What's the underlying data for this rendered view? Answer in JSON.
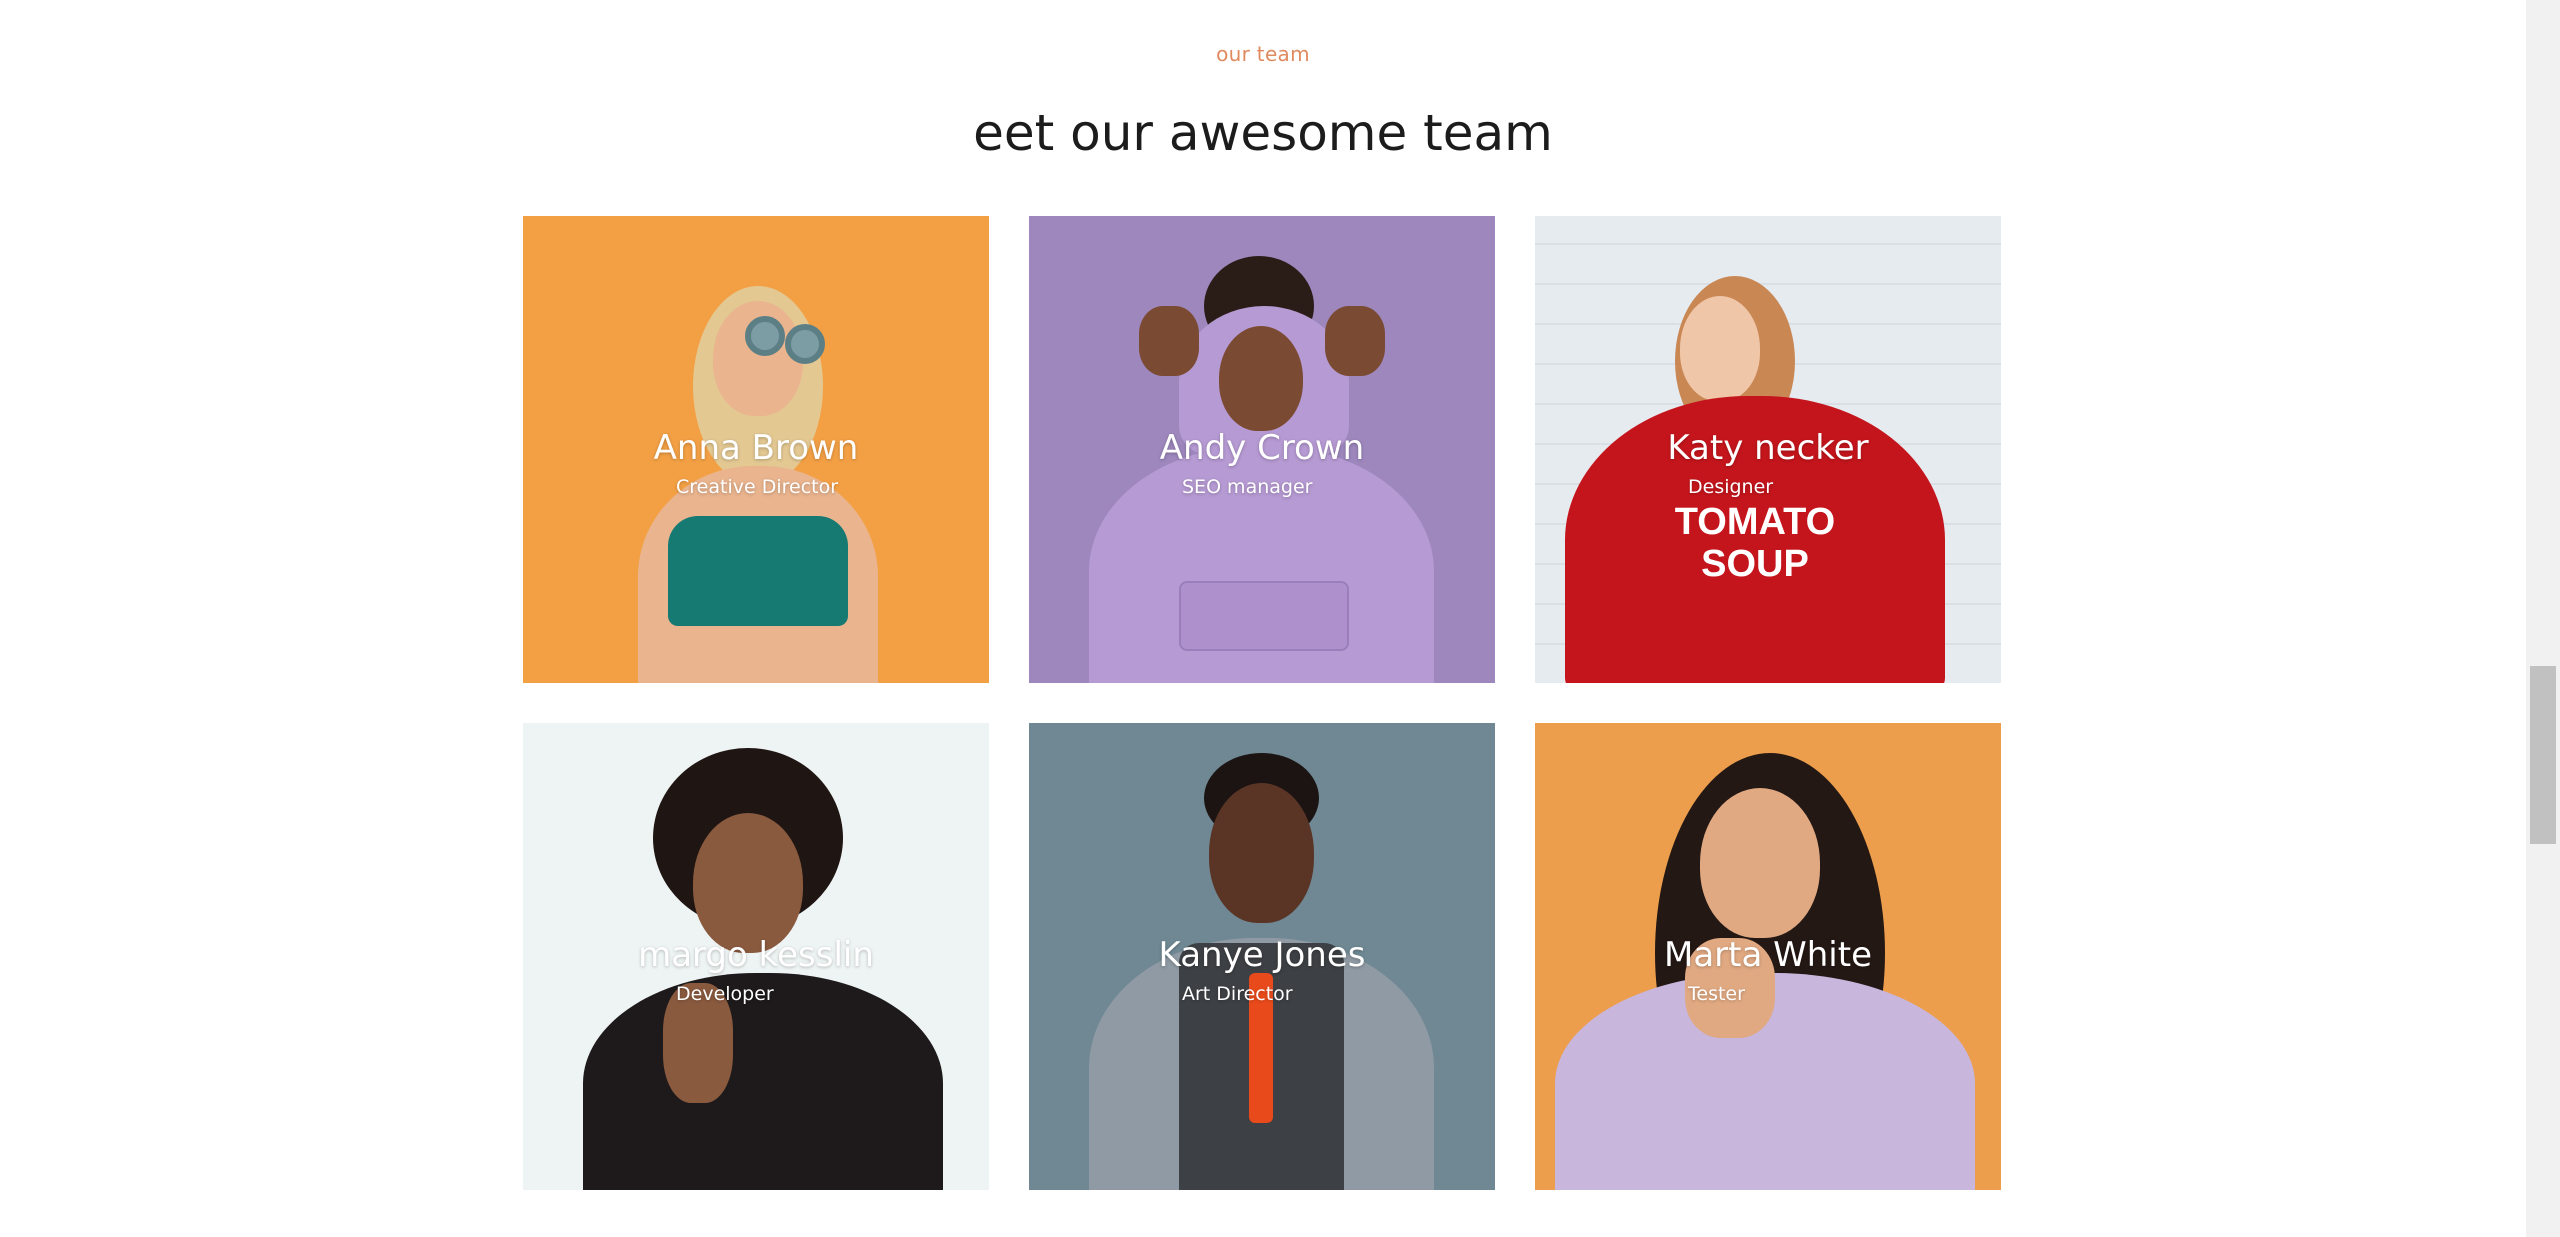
{
  "section": {
    "eyebrow": "our team",
    "title": "eet our awesome team"
  },
  "members": [
    {
      "name": "Anna Brown",
      "role": "Creative Director",
      "bg": "#f3a045"
    },
    {
      "name": "Andy Crown",
      "role": "SEO manager",
      "bg": "#9d87bd"
    },
    {
      "name": "Katy necker",
      "role": "Designer",
      "bg": "#e9eef3"
    },
    {
      "name": "margo kesslin",
      "role": "Developer",
      "bg": "#eef4f3"
    },
    {
      "name": "Kanye Jones",
      "role": "Art Director",
      "bg": "#6f8893"
    },
    {
      "name": "Marta White",
      "role": "Tester",
      "bg": "#ec9e4c"
    }
  ],
  "colors": {
    "accent": "#e08a60",
    "title": "#1c1c1c"
  }
}
